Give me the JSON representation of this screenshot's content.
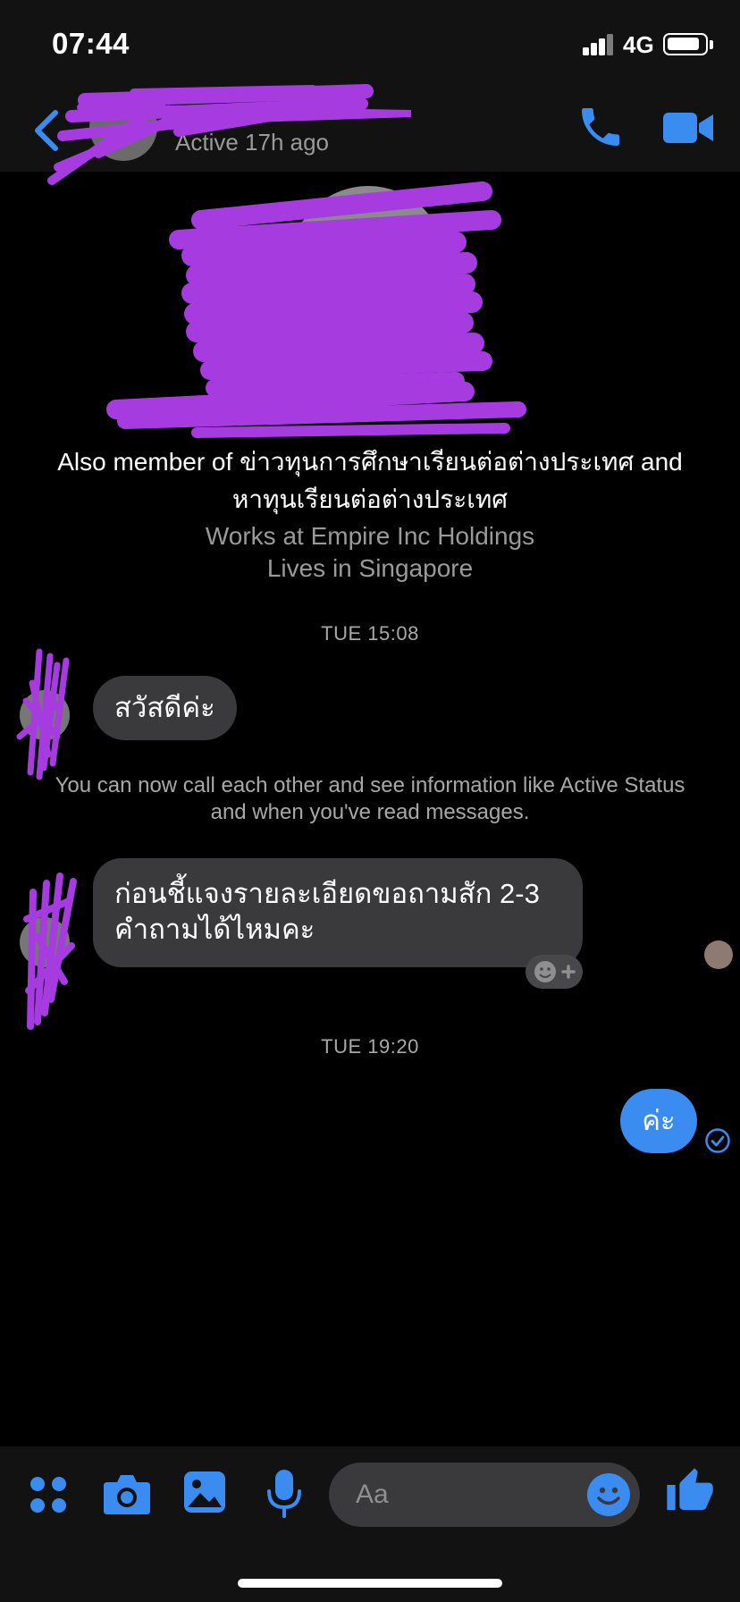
{
  "status_bar": {
    "time": "07:44",
    "network": "4G"
  },
  "header": {
    "active_status": "Active 17h ago"
  },
  "profile": {
    "member_of": "Also member of ข่าวทุนการศึกษาเรียนต่อต่างประเทศ and หาทุนเรียนต่อต่างประเทศ",
    "works_at": "Works at Empire Inc Holdings",
    "lives_in": "Lives in Singapore"
  },
  "conversation": {
    "timestamp_1": "TUE 15:08",
    "message_1": "สวัสดีค่ะ",
    "system_notice": "You can now call each other and see information like Active Status and when you've read messages.",
    "message_2_line_1": "ก่อนชี้แจงรายละเอียดขอถามสัก 2-3",
    "message_2_line_2": "คำถามได้ไหมคะ",
    "timestamp_2": "TUE 19:20",
    "message_3": "ค่ะ"
  },
  "composer": {
    "placeholder": "Aa"
  },
  "colors": {
    "accent": "#3a8cf0",
    "scribble": "#a63ce0",
    "bubble_in": "#3a3a3c",
    "bar": "#121212"
  },
  "icons": [
    "back-arrow-icon",
    "phone-icon",
    "video-camera-icon",
    "apps-grid-icon",
    "camera-icon",
    "gallery-icon",
    "microphone-icon",
    "emoji-icon",
    "thumbs-up-icon",
    "add-reaction-icon",
    "sent-check-icon"
  ]
}
